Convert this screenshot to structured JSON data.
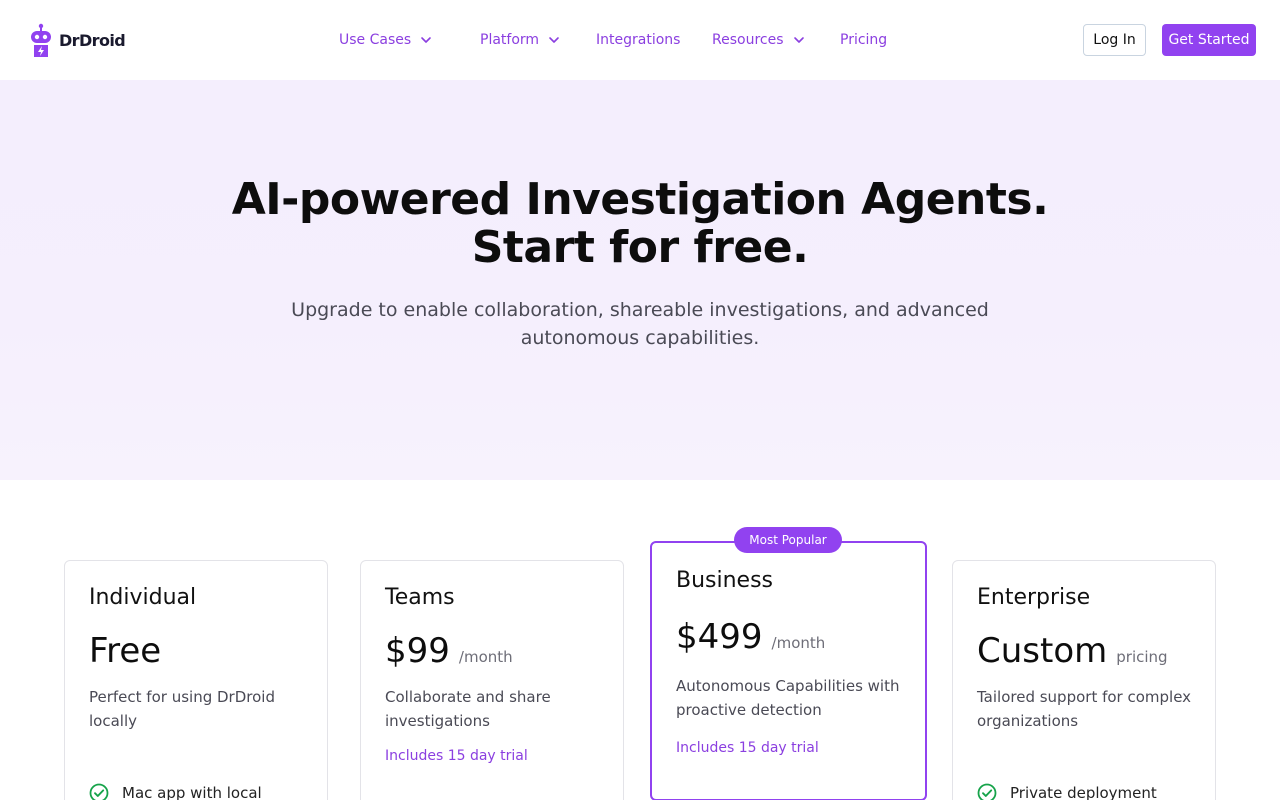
{
  "brand": {
    "name": "DrDroid",
    "logo_icon": "robot-logo-icon",
    "accent": "#9142f0"
  },
  "nav": {
    "items": [
      {
        "label": "Use Cases",
        "has_dropdown": true
      },
      {
        "label": "Platform",
        "has_dropdown": true
      },
      {
        "label": "Integrations",
        "has_dropdown": false
      },
      {
        "label": "Resources",
        "has_dropdown": true
      },
      {
        "label": "Pricing",
        "has_dropdown": false
      }
    ],
    "login_label": "Log In",
    "cta_label": "Get Started"
  },
  "hero": {
    "title_line1": "AI-powered Investigation Agents.",
    "title_line2": "Start for free.",
    "subtitle": "Upgrade to enable collaboration, shareable investigations, and advanced autonomous capabilities."
  },
  "plans": [
    {
      "name": "Individual",
      "price": "Free",
      "period": "",
      "description": "Perfect for using DrDroid locally",
      "trial": "",
      "first_feature": "Mac app with local"
    },
    {
      "name": "Teams",
      "price": "$99",
      "period": "/month",
      "description": "Collaborate and share investigations",
      "trial": "Includes 15 day trial",
      "first_feature": ""
    },
    {
      "name": "Business",
      "price": "$499",
      "period": "/month",
      "description": "Autonomous Capabilities with proactive detection",
      "trial": "Includes 15 day trial",
      "first_feature": "",
      "badge": "Most Popular"
    },
    {
      "name": "Enterprise",
      "price": "Custom",
      "period": "pricing",
      "description": "Tailored support for complex organizations",
      "trial": "",
      "first_feature": "Private deployment"
    }
  ]
}
